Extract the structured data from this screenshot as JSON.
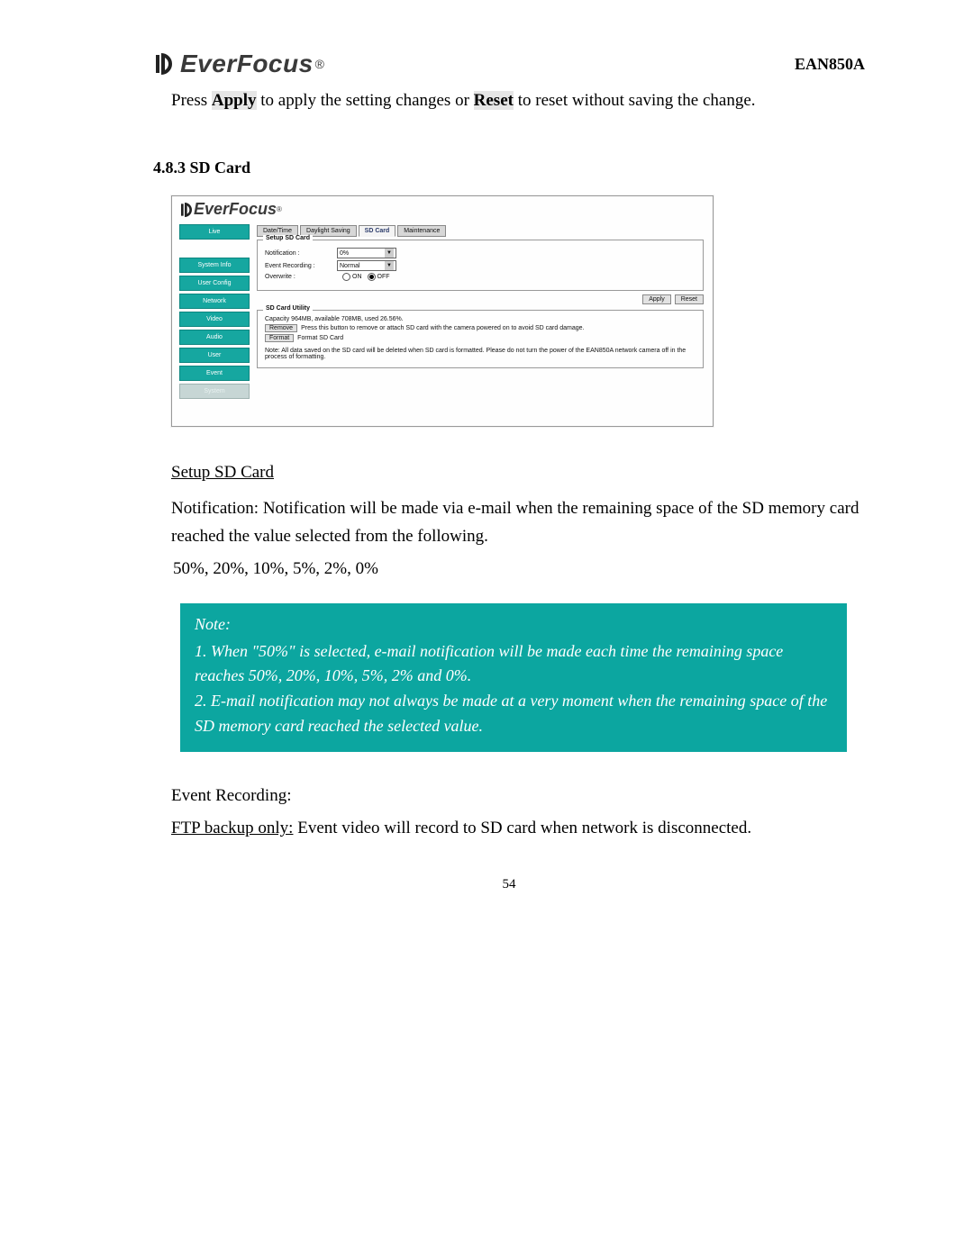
{
  "header": {
    "brand_name": "EverFocus",
    "registered": "®",
    "model": "EAN850A"
  },
  "intro": {
    "pre": "Press ",
    "apply": "Apply",
    "mid": " to apply the setting changes or ",
    "reset": "Reset",
    "post": " to reset without saving the change."
  },
  "section_title": "4.8.3 SD Card",
  "ui": {
    "brand_name": "EverFocus",
    "registered": "®",
    "sidebar": {
      "live": "Live",
      "system_info": "System Info",
      "user_config": "User Config",
      "network": "Network",
      "video": "Video",
      "audio": "Audio",
      "user": "User",
      "event": "Event",
      "system": "System"
    },
    "tabs": {
      "datetime": "Date/Time",
      "dst": "Daylight Saving",
      "sdcard": "SD Card",
      "maintenance": "Maintenance"
    },
    "setup_group_title": "Setup SD Card",
    "rows": {
      "notification_label": "Notification :",
      "notification_value": "0%",
      "event_label": "Event Recording :",
      "event_value": "Normal",
      "overwrite_label": "Overwrite :",
      "overwrite_on": "ON",
      "overwrite_off": "OFF"
    },
    "dropdown_arrow": "▼",
    "apply_btn": "Apply",
    "reset_btn": "Reset",
    "utility_group_title": "SD Card Utility",
    "utility": {
      "capacity_line": "Capacity 964MB, available 708MB, used 26.56%.",
      "remove_btn": "Remove",
      "remove_text": "Press this button to remove or attach SD card with the camera powered on to avoid SD card damage.",
      "format_btn": "Format",
      "format_text": "Format SD Card",
      "note": "Note: All data saved on the SD card will be deleted when SD card is formatted. Please do not turn the power of the EAN850A network camera off in the process of formatting."
    }
  },
  "setup_subhead": "Setup SD Card",
  "notification_para": "Notification: Notification will be made via e-mail when the remaining space of the SD memory card reached the value selected from the following.",
  "percent_line": "50%, 20%, 10%, 5%, 2%, 0%",
  "note": {
    "title": "Note:",
    "line1": "1. When \"50%\" is selected, e-mail notification will be made each time the remaining space reaches 50%, 20%, 10%, 5%, 2% and 0%.",
    "line2": "2. E-mail notification may not always be made at a very moment when the remaining space of the SD memory card reached the selected value."
  },
  "event_recording_label": "Event Recording:",
  "ftp_label": "FTP backup only:",
  "ftp_text": " Event video will record to SD card when network is disconnected.",
  "page_number": "54"
}
